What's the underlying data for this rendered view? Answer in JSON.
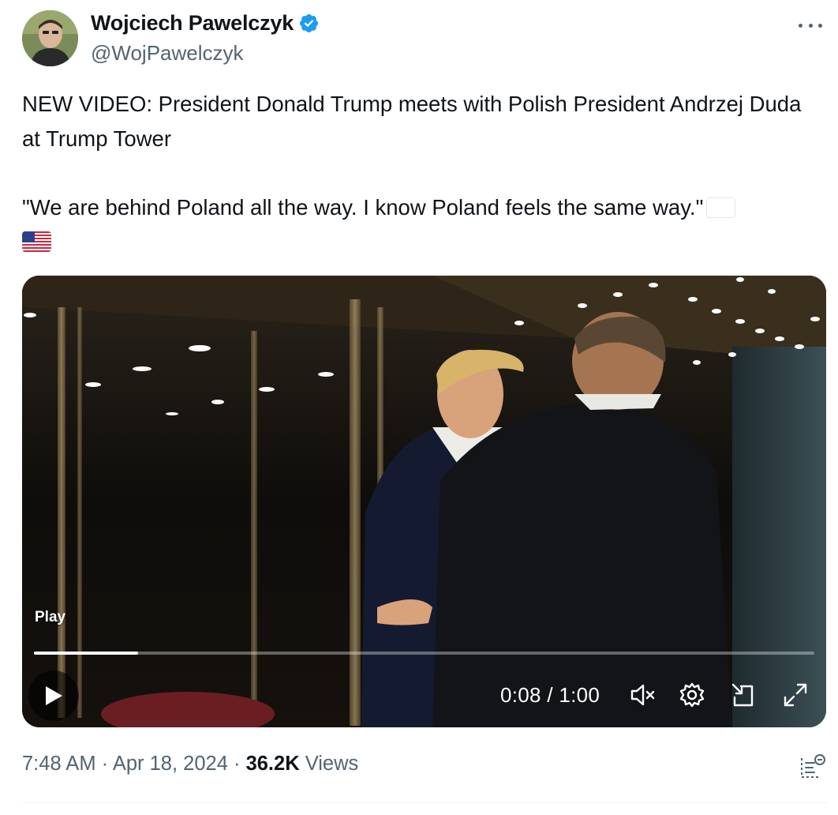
{
  "author": {
    "display_name": "Wojciech Pawelczyk",
    "handle": "@WojPawelczyk",
    "verified_icon": "verified-badge-icon",
    "avatar_icon": "avatar"
  },
  "menu": {
    "more_icon": "more-icon"
  },
  "tweet": {
    "line1": "NEW VIDEO: President Donald Trump meets with Polish President Andrzej Duda at Trump Tower",
    "quote": "\"We are behind Poland all the way. I know Poland feels the same way.\"",
    "flags": [
      "flag-poland-icon",
      "flag-usa-icon"
    ]
  },
  "video": {
    "play_label": "Play",
    "current_time": "0:08",
    "duration": "1:00",
    "time_display": "0:08 / 1:00",
    "progress_fraction": 0.133,
    "controls": [
      "play-icon",
      "mute-icon",
      "settings-icon",
      "pip-icon",
      "fullscreen-icon"
    ]
  },
  "meta": {
    "time": "7:48 AM",
    "separator": "·",
    "date": "Apr 18, 2024",
    "views_count": "36.2K",
    "views_label": "Views",
    "analytics_icon": "analytics-icon"
  },
  "colors": {
    "text": "#0f1419",
    "secondary": "#536471",
    "verified": "#1d9bf0"
  }
}
